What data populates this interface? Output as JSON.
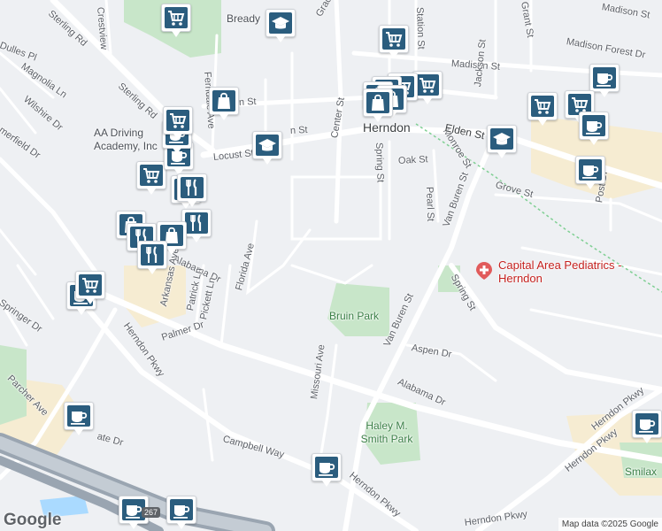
{
  "map": {
    "colors": {
      "background": "#eef0f3",
      "park": "#c8e6c9",
      "road": "#ffffff",
      "highway": "#9aa5b1",
      "commercial": "#f6ecd2",
      "marker": "#2b5d7e"
    },
    "town_label": "Herndon",
    "streets": [
      {
        "name": "Sterling Rd"
      },
      {
        "name": "Crestview"
      },
      {
        "name": "Dulles Pl"
      },
      {
        "name": "Magnolia Ln"
      },
      {
        "name": "Wilshire Dr"
      },
      {
        "name": "Sterling Rd"
      },
      {
        "name": "merfield Dr"
      },
      {
        "name": "Ferndale Ave"
      },
      {
        "name": "Grace St"
      },
      {
        "name": "Station St"
      },
      {
        "name": "Grant St"
      },
      {
        "name": "Madison Forest Dr"
      },
      {
        "name": "Madison St"
      },
      {
        "name": "Jackson St"
      },
      {
        "name": "Monroe St"
      },
      {
        "name": "Elden St"
      },
      {
        "name": "Center St"
      },
      {
        "name": "Spring St"
      },
      {
        "name": "Oak St"
      },
      {
        "name": "Locust St"
      },
      {
        "name": "Pearl St"
      },
      {
        "name": "Grove St"
      },
      {
        "name": "Post Dr"
      },
      {
        "name": "Van Buren St"
      },
      {
        "name": "Spring St"
      },
      {
        "name": "Alabama Dr"
      },
      {
        "name": "Arkansas Ave"
      },
      {
        "name": "Patrick Ln"
      },
      {
        "name": "Pickett Ln"
      },
      {
        "name": "Florida Ave"
      },
      {
        "name": "Palmer Dr"
      },
      {
        "name": "Springer Dr"
      },
      {
        "name": "Herndon Pkwy"
      },
      {
        "name": "Van Buren St"
      },
      {
        "name": "Aspen Dr"
      },
      {
        "name": "Alabama Dr"
      },
      {
        "name": "Missouri Ave"
      },
      {
        "name": "Parcher Ave"
      },
      {
        "name": "Campbell Way"
      },
      {
        "name": "Herndon Pkwy"
      },
      {
        "name": "Herndon Pkwy"
      },
      {
        "name": "Herndon Pkwy"
      },
      {
        "name": "Herndon Pkwy"
      },
      {
        "name": "ate Dr"
      },
      {
        "name": "Madison St"
      },
      {
        "name": "n St"
      },
      {
        "name": "n St"
      }
    ],
    "places": [
      {
        "name": "Bready"
      },
      {
        "name": "AA Driving Academy, Inc"
      },
      {
        "name": "Bruin Park"
      },
      {
        "name": "Haley M. Smith Park"
      },
      {
        "name": "Capital Area Pediatrics - Herndon"
      },
      {
        "name": "Smilax"
      }
    ],
    "markers": [
      {
        "icon": "school-icon"
      },
      {
        "icon": "cart-icon"
      },
      {
        "icon": "cart-icon"
      },
      {
        "icon": "cart-icon"
      },
      {
        "icon": "shopping-bag-icon"
      },
      {
        "icon": "shopping-bag-icon"
      },
      {
        "icon": "shopping-bag-icon"
      },
      {
        "icon": "shopping-bag-icon"
      },
      {
        "icon": "coffee-icon"
      },
      {
        "icon": "cart-icon"
      },
      {
        "icon": "cart-icon"
      },
      {
        "icon": "coffee-icon"
      },
      {
        "icon": "school-icon"
      },
      {
        "icon": "shopping-bag-icon"
      },
      {
        "icon": "coffee-icon"
      },
      {
        "icon": "school-icon"
      },
      {
        "icon": "cart-icon"
      },
      {
        "icon": "coffee-icon"
      },
      {
        "icon": "coffee-icon"
      },
      {
        "icon": "restaurant-icon"
      },
      {
        "icon": "restaurant-icon"
      },
      {
        "icon": "shopping-bag-icon"
      },
      {
        "icon": "restaurant-icon"
      },
      {
        "icon": "restaurant-icon"
      },
      {
        "icon": "shopping-bag-icon"
      },
      {
        "icon": "restaurant-icon"
      },
      {
        "icon": "coffee-icon"
      },
      {
        "icon": "cart-icon"
      },
      {
        "icon": "coffee-icon"
      },
      {
        "icon": "coffee-icon"
      },
      {
        "icon": "coffee-icon"
      },
      {
        "icon": "coffee-icon"
      },
      {
        "icon": "coffee-icon"
      },
      {
        "icon": "cart-icon"
      },
      {
        "icon": "cart-icon"
      }
    ],
    "route_shield": "267",
    "google_logo": "Google",
    "attribution": "Map data ©2025 Google"
  }
}
